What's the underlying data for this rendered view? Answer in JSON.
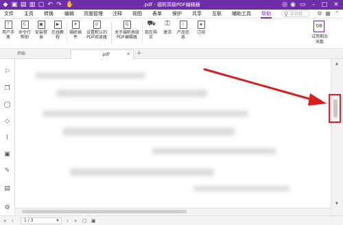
{
  "window": {
    "title": ".pdf - 福昕高级PDF编辑器",
    "brand_color": "#6f2da8"
  },
  "menubar": {
    "items": [
      {
        "label": "文件"
      },
      {
        "label": "主页"
      },
      {
        "label": "转换"
      },
      {
        "label": "编辑"
      },
      {
        "label": "页面管理"
      },
      {
        "label": "注释"
      },
      {
        "label": "视图"
      },
      {
        "label": "表单"
      },
      {
        "label": "保护"
      },
      {
        "label": "共享"
      },
      {
        "label": "互联"
      },
      {
        "label": "辅助工具"
      },
      {
        "label": "帮助",
        "active": true
      }
    ],
    "search_placeholder": "告诉我"
  },
  "ribbon": {
    "buttons": [
      {
        "label": "用户手册",
        "icon": "manual-icon"
      },
      {
        "label": "命令行帮助",
        "icon": "cmd-icon"
      },
      {
        "label": "安装登录",
        "icon": "install-icon"
      },
      {
        "label": "在线教程",
        "icon": "tutorial-icon"
      },
      {
        "label": "福昕插件",
        "icon": "plugin-icon"
      },
      {
        "label": "设置默认的PDF阅读器",
        "icon": "default-reader-icon"
      },
      {
        "label": "关于福昕高级PDF编辑器",
        "icon": "about-icon"
      },
      {
        "label": "现在购买",
        "icon": "cart-icon"
      },
      {
        "label": "激活",
        "icon": "key-icon"
      },
      {
        "label": "产品信息",
        "icon": "info-icon"
      },
      {
        "label": "订阅",
        "icon": "subscribe-icon"
      }
    ],
    "trial": {
      "days": "08",
      "label": "试用剩余天数"
    }
  },
  "tabs": {
    "start_label": "开始",
    "doc_label": ".pdf"
  },
  "status": {
    "page_indicator": "1 / 3"
  }
}
